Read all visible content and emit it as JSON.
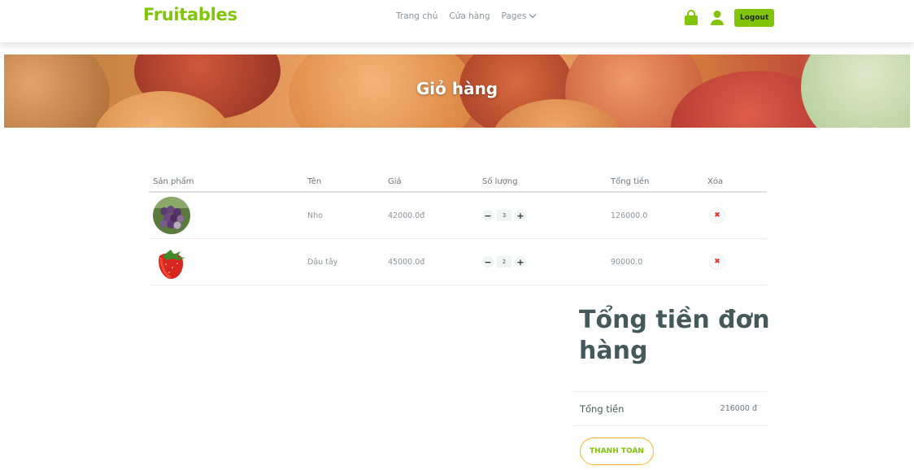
{
  "brand": "Fruitables",
  "nav": {
    "links": [
      "Trang chủ",
      "Cửa hàng",
      "Pages"
    ],
    "logout_label": "Logout"
  },
  "hero": {
    "title": "Giỏ hàng"
  },
  "table": {
    "headers": [
      "Sản phẩm",
      "Tên",
      "Giá",
      "Số lượng",
      "Tổng tiền",
      "Xóa"
    ],
    "rows": [
      {
        "image": "grapes-image",
        "name": "Nho",
        "price": "42000.0đ",
        "quantity": "3",
        "total": "126000.0"
      },
      {
        "image": "strawberry-image",
        "name": "Dâu tây",
        "price": "45000.0đ",
        "quantity": "2",
        "total": "90000.0"
      }
    ],
    "minus": "−",
    "plus": "+",
    "delete": "✖"
  },
  "summary": {
    "title": "Tổng tiền đơn hàng",
    "total_label": "Tổng tiền",
    "total_value": "216000 đ",
    "checkout_label": "THANH TOÁN"
  },
  "colors": {
    "brand": "#81c408",
    "accent": "#ffb524",
    "heading": "#45595b"
  }
}
